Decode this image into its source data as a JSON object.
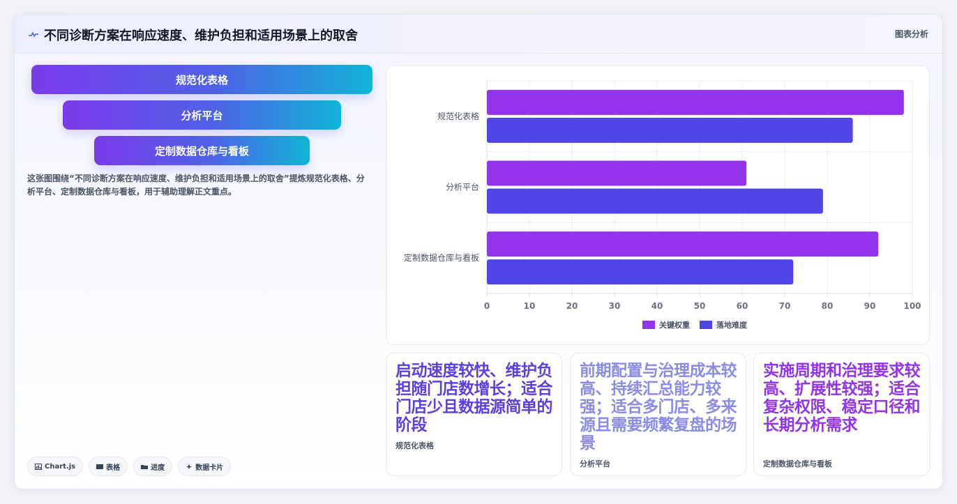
{
  "header": {
    "icon": "pulse-line-icon",
    "title": "不同诊断方案在响应速度、维护负担和适用场景上的取舍",
    "right_label": "图表分析"
  },
  "funnel": {
    "items": [
      "规范化表格",
      "分析平台",
      "定制数据仓库与看板"
    ]
  },
  "description": "这张图围绕“不同诊断方案在响应速度、维护负担和适用场景上的取舍”提炼规范化表格、分析平台、定制数据仓库与看板，用于辅助理解正文重点。",
  "tags": [
    {
      "icon": "chart-icon",
      "label": "Chart.js"
    },
    {
      "icon": "table-icon",
      "label": "表格"
    },
    {
      "icon": "progress-icon",
      "label": "进度"
    },
    {
      "icon": "sparkle-icon",
      "label": "数据卡片"
    }
  ],
  "chart_data": {
    "type": "bar",
    "orientation": "horizontal",
    "categories": [
      "规范化表格",
      "分析平台",
      "定制数据仓库与看板"
    ],
    "series": [
      {
        "name": "关键权重",
        "color": "#9333ea",
        "values": [
          98,
          61,
          92
        ]
      },
      {
        "name": "落地难度",
        "color": "#4f46e5",
        "values": [
          86,
          79,
          72
        ]
      }
    ],
    "xlim": [
      0,
      100
    ],
    "xticks": [
      0,
      10,
      20,
      30,
      40,
      50,
      60,
      70,
      80,
      90,
      100
    ],
    "grid": true,
    "legend_position": "bottom"
  },
  "cards": [
    {
      "value": "启动速度较快、维护负担随门店数增长；适合门店少且数据源简单的阶段",
      "label": "规范化表格"
    },
    {
      "value": "前期配置与治理成本较高、持续汇总能力较强；适合多门店、多来源且需要频繁复盘的场景",
      "label": "分析平台"
    },
    {
      "value": "实施周期和治理要求较高、扩展性较强；适合复杂权限、稳定口径和长期分析需求",
      "label": "定制数据仓库与看板"
    }
  ]
}
